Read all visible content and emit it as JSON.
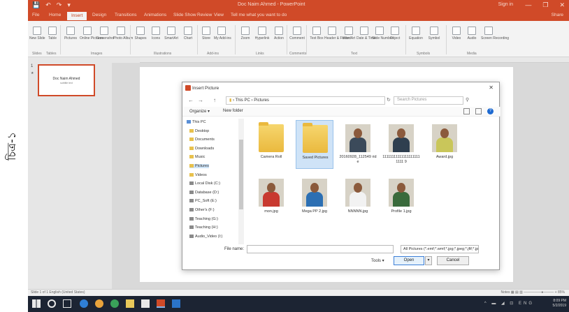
{
  "side_caption": "চিত্র-১",
  "app": {
    "window_title": "Doc Naim Ahmed - PowerPoint",
    "signin": "Sign in",
    "qat": [
      "💾",
      "↶",
      "↷",
      "▾"
    ],
    "win_buttons": [
      "—",
      "❐",
      "✕"
    ],
    "tabs": [
      "File",
      "Home",
      "Insert",
      "Design",
      "Transitions",
      "Animations",
      "Slide Show",
      "Review",
      "View"
    ],
    "active_tab": "Insert",
    "tell_me": "Tell me what you want to do",
    "share": "Share"
  },
  "ribbon": {
    "buttons": [
      "New Slide",
      "Table",
      "Pictures",
      "Online Pictures",
      "Screenshot",
      "Photo Album",
      "Shapes",
      "Icons",
      "SmartArt",
      "Chart",
      "Store",
      "My Add-ins",
      "Zoom",
      "Hyperlink",
      "Action",
      "Comment",
      "Text Box",
      "Header & Footer",
      "WordArt",
      "Date & Time",
      "Slide Number",
      "Object",
      "Equation",
      "Symbol",
      "Video",
      "Audio",
      "Screen Recording"
    ],
    "groups": [
      "Slides",
      "Tables",
      "Images",
      "Illustrations",
      "Add-ins",
      "Links",
      "Comments",
      "Text",
      "Symbols",
      "Media"
    ]
  },
  "thumbnail": {
    "number": "1",
    "star": "★",
    "title": "Doc Naim Ahmed",
    "subtitle": "subtitle text"
  },
  "dialog": {
    "title": "Insert Picture",
    "close": "✕",
    "nav": [
      "←",
      "→",
      "↑"
    ],
    "path": [
      "This PC",
      "Pictures"
    ],
    "search_placeholder": "Search Pictures",
    "organize": "Organize ▾",
    "new_folder": "New folder",
    "help": "?",
    "tree": [
      {
        "label": "This PC",
        "icon": "pc"
      },
      {
        "label": "Desktop",
        "icon": "folder"
      },
      {
        "label": "Documents",
        "icon": "folder"
      },
      {
        "label": "Downloads",
        "icon": "folder"
      },
      {
        "label": "Music",
        "icon": "folder"
      },
      {
        "label": "Pictures",
        "icon": "folder",
        "selected": true
      },
      {
        "label": "Videos",
        "icon": "folder"
      },
      {
        "label": "Local Disk (C:)",
        "icon": "drive"
      },
      {
        "label": "Database (D:)",
        "icon": "drive"
      },
      {
        "label": "PC_Soft (E:)",
        "icon": "drive"
      },
      {
        "label": "Other's (F:)",
        "icon": "drive"
      },
      {
        "label": "Teaching (G:)",
        "icon": "drive"
      },
      {
        "label": "Teaching (H:)",
        "icon": "drive"
      },
      {
        "label": "Audio_Video (I:)",
        "icon": "drive"
      }
    ],
    "files": [
      {
        "name": "Camera Roll",
        "kind": "folder"
      },
      {
        "name": "Saved Pictures",
        "kind": "folder",
        "selected": true
      },
      {
        "name": "20160928_112549 ride",
        "kind": "photo",
        "shirt": "#3b4a5a"
      },
      {
        "name": "111111111111111111111111 9",
        "kind": "photo",
        "shirt": "#2f3f4f"
      },
      {
        "name": "Award.jpg",
        "kind": "photo",
        "shirt": "#c9c65a"
      },
      {
        "name": "mon.jpg",
        "kind": "photo",
        "shirt": "#c8392f"
      },
      {
        "name": "Mega PP 2.jpg",
        "kind": "photo",
        "shirt": "#2c6fb3"
      },
      {
        "name": "NNNNN.jpg",
        "kind": "photo",
        "shirt": "#f2f2f2"
      },
      {
        "name": "Profile 1.jpg",
        "kind": "photo",
        "shirt": "#3a6b3c"
      }
    ],
    "file_name_label": "File name:",
    "filter": "All Pictures (*.emf;*.wmf;*.jpg;*.jpeg;*.jfif;*.jpe;*.png;*.bmp;*.dib;*.rle;*.gif)",
    "tools": "Tools ▾",
    "open": "Open",
    "open_arrow": "▾",
    "cancel": "Cancel"
  },
  "statusbar": {
    "left": "Slide 1 of 1   English (United States)",
    "right": "Notes   ▦   ▤   ▥   —————●——— + 85%"
  },
  "taskbar": {
    "clock_time": "8:09 PM",
    "clock_date": "5/2/2019",
    "tray": "^ ▬ ◢ ⊡ ENG"
  }
}
